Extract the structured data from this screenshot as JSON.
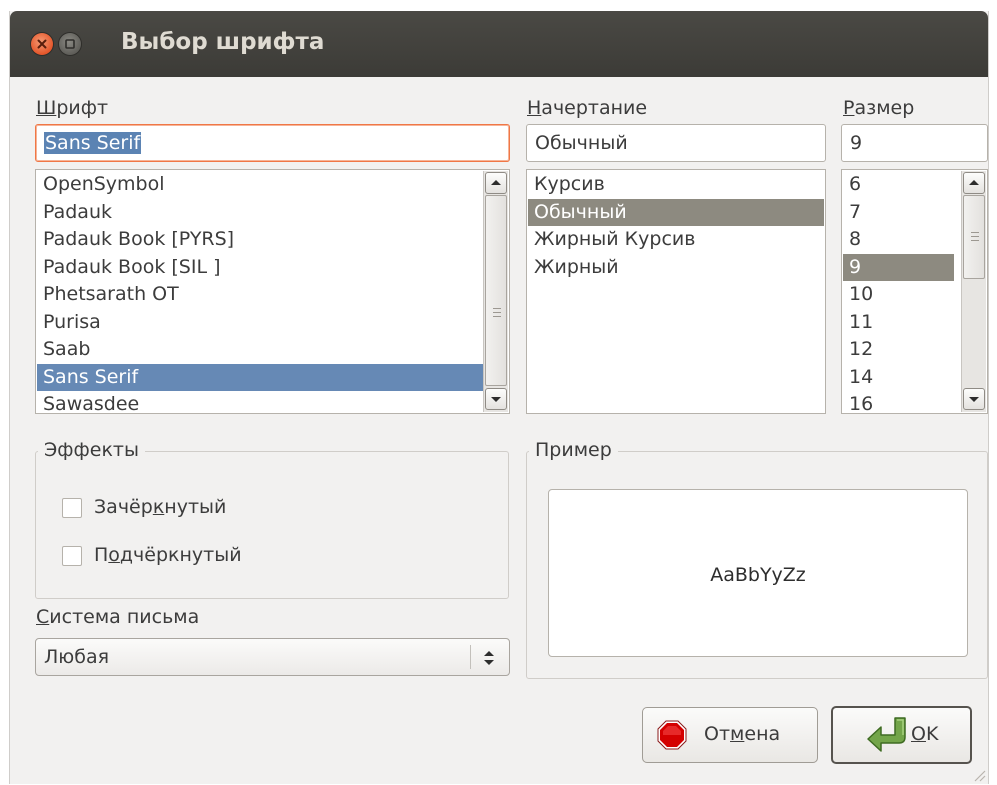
{
  "window": {
    "title": "Выбор шрифта"
  },
  "font": {
    "label_ul": "Ш",
    "label_rest": "рифт",
    "value": "Sans Serif",
    "items": [
      "OpenSymbol",
      "Padauk",
      "Padauk Book [PYRS]",
      "Padauk Book [SIL ]",
      "Phetsarath OT",
      "Purisa",
      "Saab",
      "Sans Serif",
      "Sawasdee"
    ],
    "selected": "Sans Serif"
  },
  "style": {
    "label_ul": "Н",
    "label_rest": "ачертание",
    "value": "Обычный",
    "items": [
      "Курсив",
      "Обычный",
      "Жирный Курсив",
      "Жирный"
    ],
    "selected": "Обычный"
  },
  "size": {
    "label_ul": "Р",
    "label_rest": "азмер",
    "value": "9",
    "items": [
      "6",
      "7",
      "8",
      "9",
      "10",
      "11",
      "12",
      "14",
      "16"
    ],
    "selected": "9"
  },
  "effects": {
    "title": "Эффекты",
    "strikeout": {
      "pre": "Зачёр",
      "ul": "к",
      "post": "нутый",
      "checked": false
    },
    "underline": {
      "pre": "П",
      "ul": "о",
      "post": "дчёркнутый",
      "checked": false
    }
  },
  "writing_system": {
    "label_ul": "С",
    "label_rest": "истема письма",
    "value": "Любая"
  },
  "sample": {
    "title": "Пример",
    "text": "AaBbYyZz"
  },
  "buttons": {
    "cancel": {
      "pre": "От",
      "ul": "м",
      "post": "ена"
    },
    "ok": {
      "ul": "O",
      "post": "K"
    }
  },
  "icons": {
    "close": "close-icon",
    "minimize": "minimize-icon",
    "cancel": "stop-icon",
    "ok": "return-arrow-icon"
  },
  "colors": {
    "titlebar": "#3c3b37",
    "close": "#e5562a",
    "focus": "#f07746",
    "selection_blue": "#6689b5",
    "selection_gray": "#8d8a80",
    "cancel_icon": "#d40000",
    "ok_icon": "#73a54a"
  }
}
